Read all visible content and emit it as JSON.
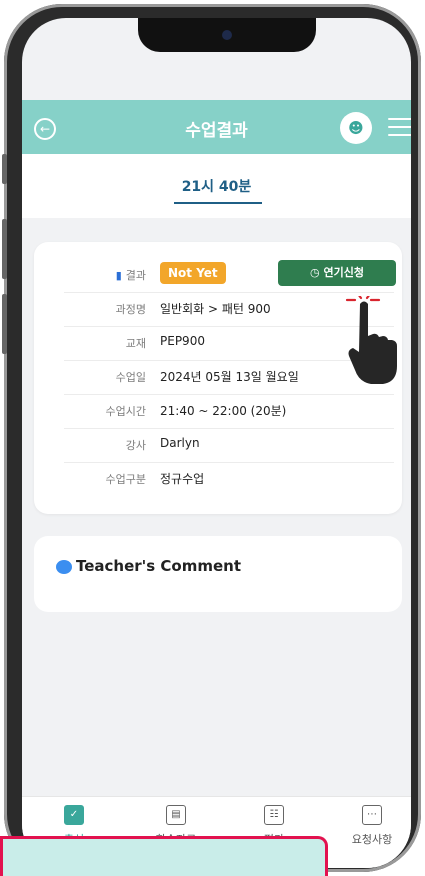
{
  "header": {
    "title": "수업결과"
  },
  "time_tab": {
    "label": "21시 40분"
  },
  "result": {
    "label": "결과",
    "status": "Not Yet",
    "defer_button": "연기신청"
  },
  "details": [
    {
      "label": "과정명",
      "value": "일반회화 > 패턴 900"
    },
    {
      "label": "교재",
      "value": "PEP900"
    },
    {
      "label": "수업일",
      "value": "2024년 05월 13일 월요일"
    },
    {
      "label": "수업시간",
      "value": "21:40 ~ 22:00 (20분)"
    },
    {
      "label": "강사",
      "value": "Darlyn"
    },
    {
      "label": "수업구분",
      "value": "정규수업"
    }
  ],
  "comment": {
    "title": "Teacher's Comment"
  },
  "tabs": [
    {
      "label": "출석"
    },
    {
      "label": "학습자료"
    },
    {
      "label": "평가"
    },
    {
      "label": "요청사항"
    }
  ],
  "icons": {
    "back": "back-arrow-icon",
    "user": "user-check-icon",
    "menu": "hamburger-menu-icon",
    "bookmark": "bookmark-icon",
    "clock": "clock-icon",
    "comment": "chat-bubble-icon",
    "pointer": "tap-hand-icon"
  },
  "colors": {
    "header": "#86d1c8",
    "accent": "#3aa79b",
    "badge": "#f2a62a",
    "defer": "#2f7d4f",
    "time": "#1f5f86",
    "popup_border": "#e2124f"
  }
}
